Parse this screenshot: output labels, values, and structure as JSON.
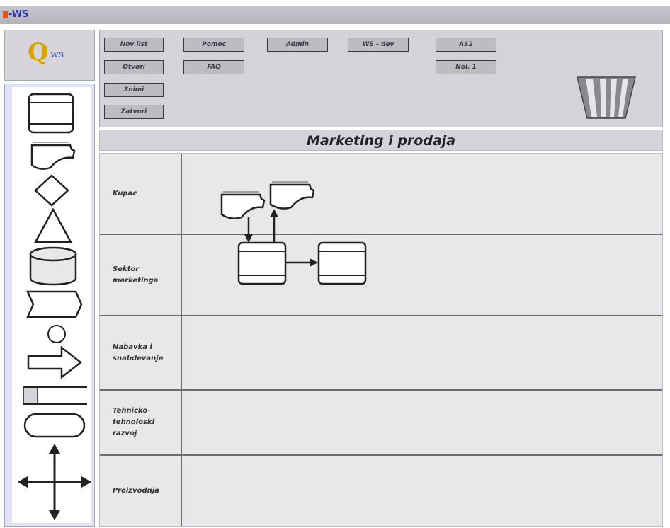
{
  "app": {
    "title": "-WS",
    "icon": "app-logo-icon"
  },
  "logo": {
    "q": "Q",
    "ws": "ws"
  },
  "toolbar": {
    "buttons": {
      "novi_list": "Nov list",
      "otvori": "Otvori",
      "snimi": "Snimi",
      "zatvori": "Zatvori",
      "pomoc": "Pomoc",
      "faq": "FAQ",
      "admin": "Admin",
      "ws_dev": "WS - dev",
      "as2": "AS2",
      "nol1": "Nol. 1"
    }
  },
  "diagram": {
    "title": "Marketing i prodaja",
    "lanes": [
      "Kupac",
      "Sektor\nmarketinga",
      "Nabavka i\nsnabdevanje",
      "Tehnicko-\ntehnoloski\nrazvoj",
      "Proizvodnja"
    ]
  },
  "palette": {
    "shapes": [
      "process-shape-icon",
      "document-shape-icon",
      "decision-shape-icon",
      "triangle-shape-icon",
      "database-shape-icon",
      "chevron-shape-icon",
      "connector-circle-icon",
      "arrow-right-shape-icon",
      "data-store-shape-icon",
      "terminator-shape-icon",
      "four-way-arrow-icon"
    ]
  },
  "colors": {
    "titlebar": "#b4b2bb",
    "app_title": "#2a3aa8",
    "logo_q": "#d9a400",
    "toolbar": "#d5d3d9",
    "lane_bg": "#e8e7ea"
  }
}
